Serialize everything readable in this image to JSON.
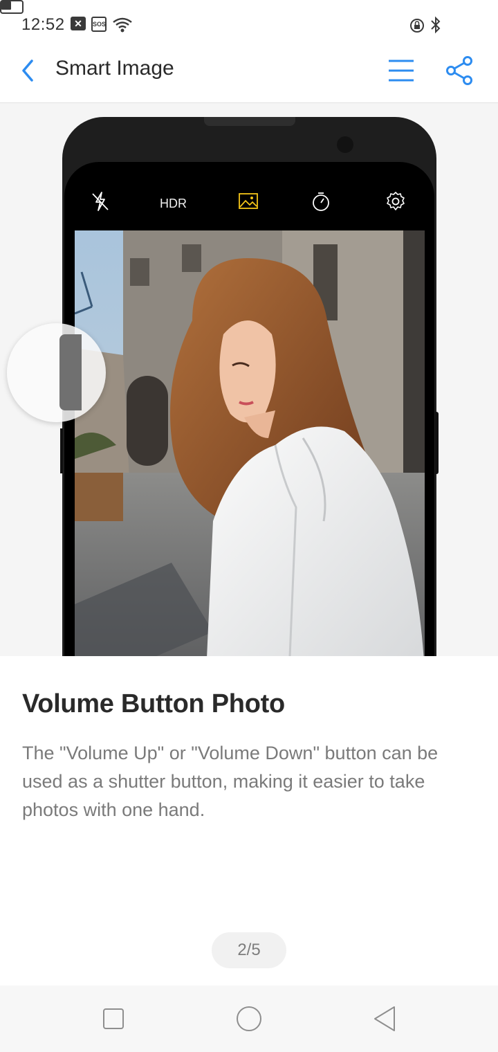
{
  "status_bar": {
    "time": "12:52",
    "icons": [
      "close-box-icon",
      "sos-icon",
      "wifi-icon",
      "rotation-lock-icon",
      "bluetooth-icon",
      "battery-icon"
    ],
    "sos_label": "SOS",
    "x_label": "✕",
    "battery_level": 0.55
  },
  "app_bar": {
    "title": "Smart Image",
    "accent_color": "#2d8cf0"
  },
  "camera_toolbar": {
    "hdr_label": "HDR",
    "active_color": "#f5c518",
    "icons": [
      "flash-off-icon",
      "hdr-icon",
      "gallery-icon",
      "timer-icon",
      "settings-icon"
    ]
  },
  "feature": {
    "title": "Volume Button Photo",
    "description": "The \"Volume Up\" or \"Volume Down\" button can be used as a shutter button, making it easier to take photos with one hand."
  },
  "pager": {
    "label": "2/5"
  },
  "nav_bar": {
    "icons": [
      "recents-square-icon",
      "home-circle-icon",
      "back-triangle-icon"
    ]
  }
}
